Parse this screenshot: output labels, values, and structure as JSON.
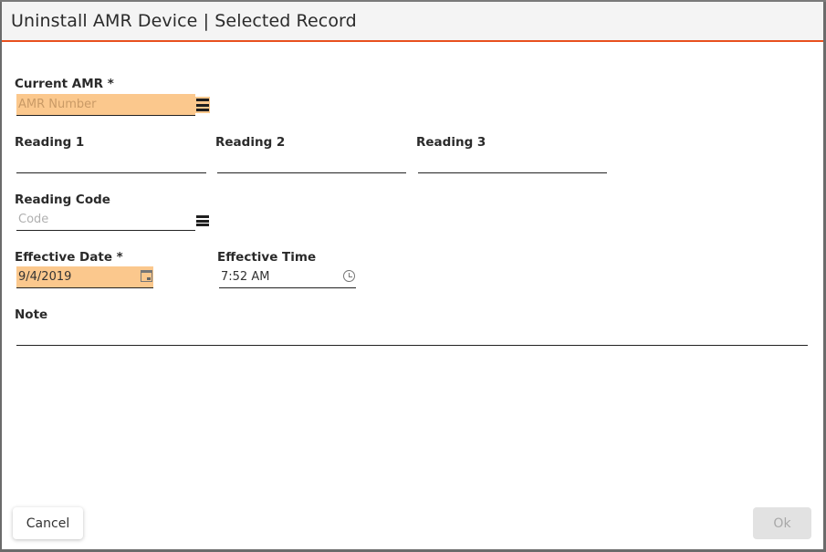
{
  "dialog": {
    "title": "Uninstall AMR Device | Selected Record",
    "accent_color": "#e8501e",
    "required_field_color": "#fbc88d"
  },
  "form": {
    "current_amr": {
      "label": "Current AMR *",
      "value": "",
      "placeholder": "AMR Number",
      "icon": "list-icon"
    },
    "reading1": {
      "label": "Reading 1",
      "value": "",
      "placeholder": ""
    },
    "reading2": {
      "label": "Reading 2",
      "value": "",
      "placeholder": ""
    },
    "reading3": {
      "label": "Reading 3",
      "value": "",
      "placeholder": ""
    },
    "reading_code": {
      "label": "Reading Code",
      "value": "",
      "placeholder": "Code",
      "icon": "list-icon"
    },
    "effective_date": {
      "label": "Effective Date *",
      "value": "9/4/2019",
      "icon": "calendar-icon"
    },
    "effective_time": {
      "label": "Effective Time",
      "value": "7:52 AM",
      "icon": "clock-icon"
    },
    "note": {
      "label": "Note",
      "value": "",
      "placeholder": ""
    }
  },
  "footer": {
    "cancel_label": "Cancel",
    "ok_label": "Ok",
    "ok_disabled": true
  }
}
